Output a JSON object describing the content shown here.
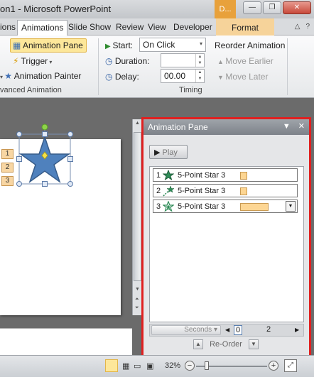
{
  "window": {
    "title": "on1  -  Microsoft PowerPoint",
    "context_tab": "D..."
  },
  "tabs": [
    "ions",
    "Animations",
    "Slide Show",
    "Review",
    "View",
    "Developer",
    "Format"
  ],
  "ribbon": {
    "animation_pane": "Animation Pane",
    "trigger": "Trigger",
    "animation_painter": "Animation Painter",
    "advanced_group": "vanced Animation",
    "start_label": "Start:",
    "start_value": "On Click",
    "duration_label": "Duration:",
    "duration_value": "",
    "delay_label": "Delay:",
    "delay_value": "00.00",
    "reorder_title": "Reorder Animation",
    "move_earlier": "Move Earlier",
    "move_later": "Move Later",
    "timing_group": "Timing"
  },
  "slide": {
    "tags": [
      "1",
      "2",
      "3"
    ]
  },
  "pane": {
    "title": "Animation Pane",
    "play": "Play",
    "items": [
      {
        "num": "1",
        "name": "5-Point Star 3",
        "effect": "entrance"
      },
      {
        "num": "2",
        "name": "5-Point Star 3",
        "effect": "motion-path"
      },
      {
        "num": "3",
        "name": "5-Point Star 3",
        "effect": "emphasis"
      }
    ],
    "seconds": "Seconds",
    "timeline_start": "0",
    "timeline_end": "2",
    "reorder": "Re-Order"
  },
  "status": {
    "zoom": "32%"
  },
  "colors": {
    "accent_red": "#e02020",
    "anim_bar": "#fdd693",
    "ribbon_highlight": "#fde79a",
    "format_tab": "#f6d39a"
  }
}
